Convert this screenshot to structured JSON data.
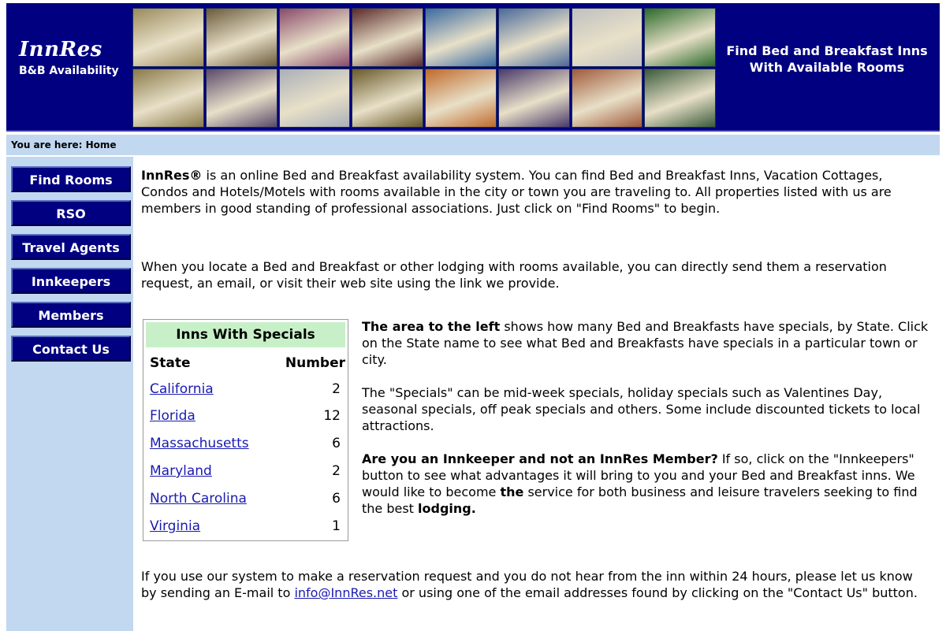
{
  "header": {
    "logo_title": "InnRes",
    "logo_subtitle": "B&B Availability",
    "tagline": "Find Bed and Breakfast Inns With Available Rooms",
    "photos": [
      {
        "color": "#9a8a5c"
      },
      {
        "color": "#6a5a3a"
      },
      {
        "color": "#8a4a6a"
      },
      {
        "color": "#5a2a2a"
      },
      {
        "color": "#3a6aa0"
      },
      {
        "color": "#4a6a9a"
      },
      {
        "color": "#c0c0c0"
      },
      {
        "color": "#2a6a2a"
      },
      {
        "color": "#8a7a4a"
      },
      {
        "color": "#5a4a6a"
      },
      {
        "color": "#aab0b8"
      },
      {
        "color": "#6a5a2a"
      },
      {
        "color": "#c06a2a"
      },
      {
        "color": "#4a3a6a"
      },
      {
        "color": "#a05a3a"
      },
      {
        "color": "#3a5a3a"
      }
    ]
  },
  "breadcrumb": "You are here: Home",
  "nav": [
    {
      "label": "Find Rooms"
    },
    {
      "label": "RSO"
    },
    {
      "label": "Travel Agents"
    },
    {
      "label": "Innkeepers"
    },
    {
      "label": "Members"
    },
    {
      "label": "Contact Us"
    }
  ],
  "intro": {
    "brand": "InnRes®",
    "text": " is an online Bed and Breakfast availability system. You can find Bed and Breakfast Inns, Vacation Cottages, Condos and Hotels/Motels with rooms available in the city or town you are traveling to. All properties listed with us are members in good standing of professional associations. Just click on \"Find Rooms\" to begin.",
    "text2": "When you locate a Bed and Breakfast or other lodging with rooms available, you can directly send them a reservation request, an email, or visit their web site using the link we provide."
  },
  "specials": {
    "title": "Inns With Specials",
    "col_state": "State",
    "col_number": "Number",
    "rows": [
      {
        "state": "California",
        "number": "2"
      },
      {
        "state": "Florida",
        "number": "12"
      },
      {
        "state": "Massachusetts",
        "number": "6"
      },
      {
        "state": "Maryland",
        "number": "2"
      },
      {
        "state": "North Carolina",
        "number": "6"
      },
      {
        "state": "Virginia",
        "number": "1"
      }
    ]
  },
  "right": {
    "p1_bold": "The area to the left",
    "p1_text": " shows how many Bed and Breakfasts have specials, by State. Click on the State name to see what Bed and Breakfasts have specials in a particular town or city.",
    "p2_text": "The \"Specials\" can be mid-week specials, holiday specials such as Valentines Day, seasonal specials, off peak specials and others. Some include discounted tickets to local attractions.",
    "p3_bold": "Are you an Innkeeper and not an InnRes Member?",
    "p3_text_a": " If so, click on the \"Innkeepers\" button to see what advantages it will bring to you and your Bed and Breakfast inns. We would like to become ",
    "p3_bold2": "the",
    "p3_text_b": " service for both business and leisure travelers seeking to find the best ",
    "p3_bold3": "lodging."
  },
  "bottom": {
    "text_a": "If you use our system to make a reservation request and you do not hear from the inn within 24 hours, please let us know by sending an E-mail to ",
    "email": "info@InnRes.net",
    "text_b": " or using one of the email addresses found by clicking on the \"Contact Us\" button."
  }
}
